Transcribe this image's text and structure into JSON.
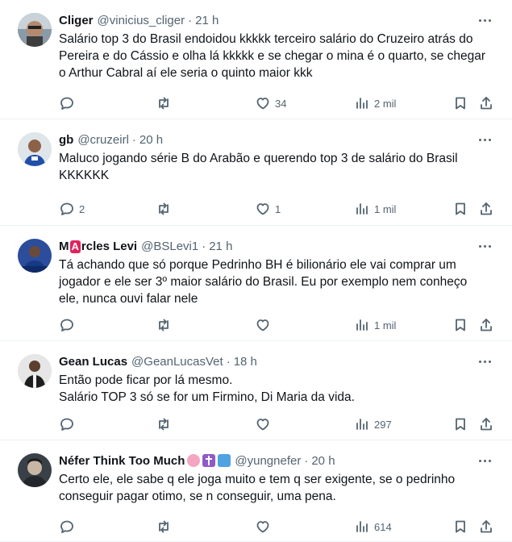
{
  "tweets": [
    {
      "name": "Cliger",
      "handle": "@vinicius_cliger",
      "time": "21 h",
      "text": "Salário top 3 do Brasil endoidou kkkkk terceiro salário do Cruzeiro atrás do\nPereira e do Cássio e olha lá kkkkk e se chegar o mina é o quarto, se chegar\no Arthur Cabral aí ele seria o quinto maior kkk",
      "replies": "",
      "retweets": "",
      "likes": "34",
      "views": "2 mil"
    },
    {
      "name": "gb",
      "handle": "@cruzeirl",
      "time": "20 h",
      "text": "Maluco jogando série B do Arabão e querendo top 3 de salário do Brasil\nKKKKKK",
      "replies": "2",
      "retweets": "",
      "likes": "1",
      "views": "1 mil"
    },
    {
      "name_prefix": "M",
      "name_badge": "A",
      "name_suffix": "rcles Levi",
      "handle": "@BSLevi1",
      "time": "21 h",
      "text": "Tá achando que só porque Pedrinho BH é bilionário ele vai comprar um\njogador e ele ser 3º maior salário do Brasil. Eu por exemplo nem conheço\nele, nunca ouvi falar nele",
      "replies": "",
      "retweets": "",
      "likes": "",
      "views": "1 mil"
    },
    {
      "name": "Gean Lucas",
      "handle": "@GeanLucasVet",
      "time": "18 h",
      "text": "Então pode ficar por lá mesmo.\nSalário TOP 3 só se for um Firmino, Di Maria da vida.",
      "replies": "",
      "retweets": "",
      "likes": "",
      "views": "297"
    },
    {
      "name": "Néfer Think Too Much",
      "name_emojis": [
        "brain-emoji",
        "cross-emoji",
        "music-notes-emoji"
      ],
      "handle": "@yungnefer",
      "time": "20 h",
      "text": "Certo ele, ele sabe q ele joga muito e tem q ser exigente, se o pedrinho\nconseguir pagar otimo, se n conseguir, uma pena.",
      "replies": "",
      "retweets": "",
      "likes": "",
      "views": "614"
    }
  ],
  "separator": "·",
  "colors": {
    "text": "#0f1419",
    "muted": "#536471",
    "border": "#eff3f4",
    "badge": "#e0245e"
  }
}
